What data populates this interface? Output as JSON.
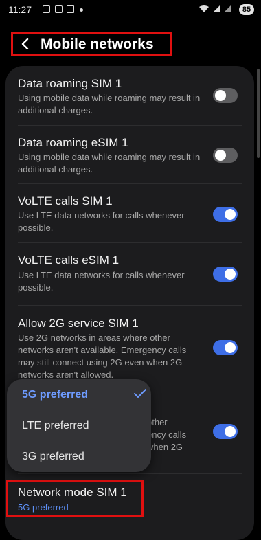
{
  "status_bar": {
    "time": "11:27",
    "battery": "85"
  },
  "header": {
    "title": "Mobile networks"
  },
  "settings": [
    {
      "title": "Data roaming SIM 1",
      "desc": "Using mobile data while roaming may result in additional charges.",
      "toggle": "off"
    },
    {
      "title": "Data roaming eSIM 1",
      "desc": "Using mobile data while roaming may result in additional charges.",
      "toggle": "off"
    },
    {
      "title": "VoLTE calls SIM 1",
      "desc": "Use LTE data networks for calls whenever possible.",
      "toggle": "on"
    },
    {
      "title": "VoLTE calls eSIM 1",
      "desc": "Use LTE data networks for calls whenever possible.",
      "toggle": "on"
    },
    {
      "title": "Allow 2G service SIM 1",
      "desc": "Use 2G networks in areas where other networks aren't available. Emergency calls may still connect using 2G even when 2G networks aren't allowed.",
      "toggle": "on"
    },
    {
      "partial_desc_line1": "other",
      "partial_desc_line2": "ency calls",
      "partial_desc_line3": "when 2G",
      "toggle": "on"
    }
  ],
  "network_mode": {
    "title": "Network mode SIM 1",
    "value": "5G preferred"
  },
  "dropdown": {
    "options": [
      "5G preferred",
      "LTE preferred",
      "3G preferred"
    ],
    "selected": "5G preferred"
  },
  "colors": {
    "accent": "#3e6ee6",
    "highlight": "#e01010",
    "selected_text": "#6e9bff"
  }
}
